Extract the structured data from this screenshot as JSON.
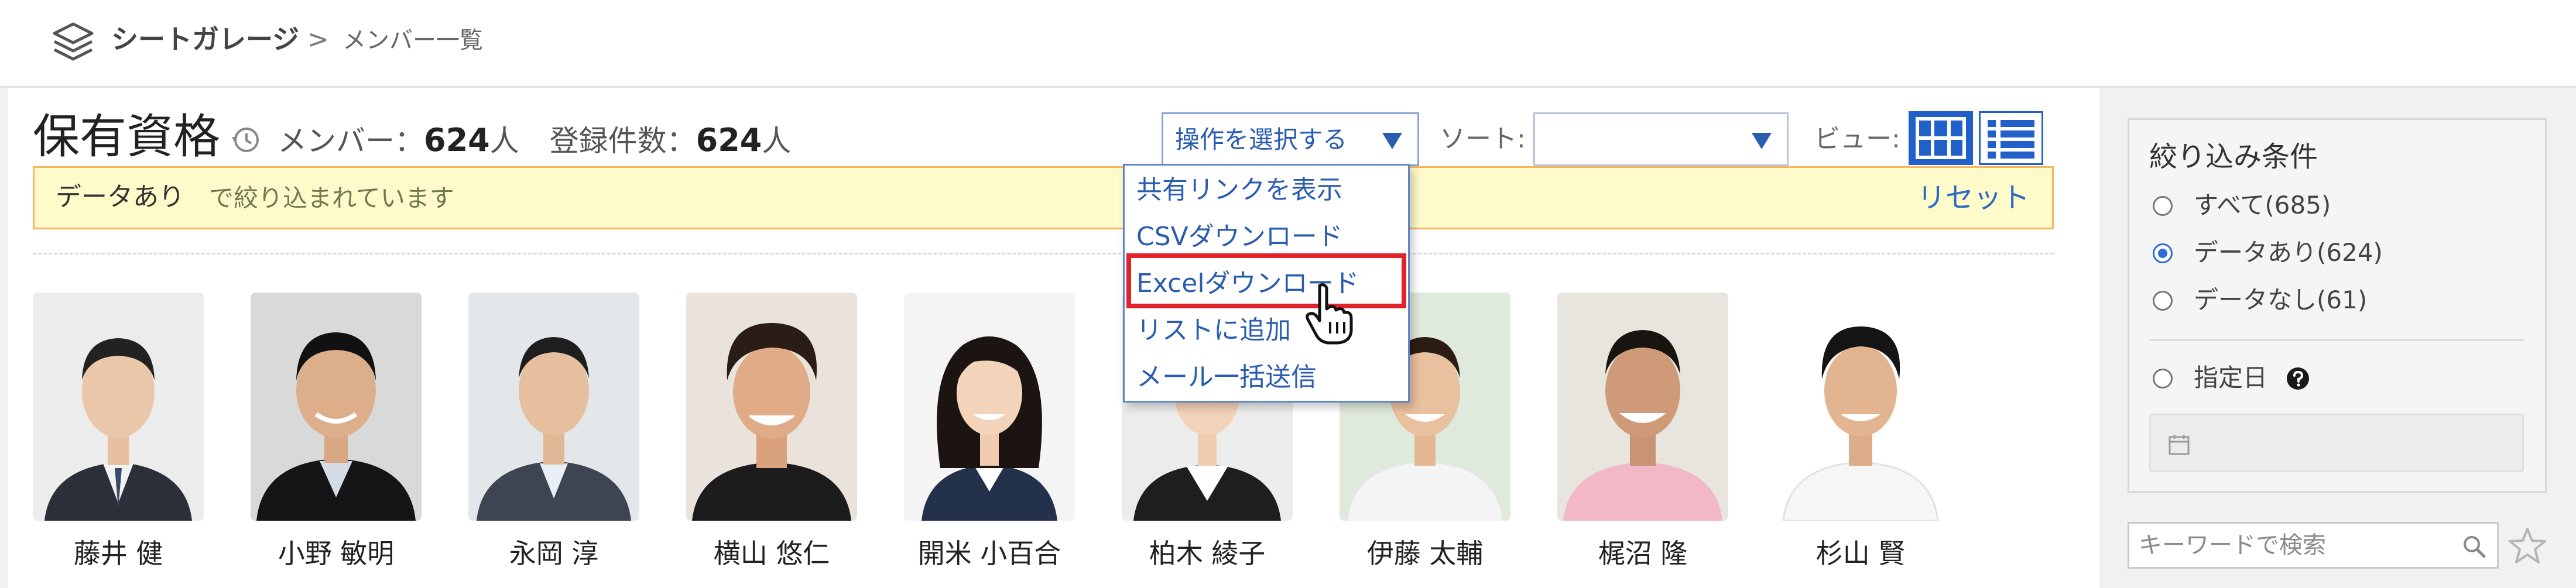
{
  "header": {
    "app_name": "シートガレージ",
    "breadcrumb_separator": ">",
    "current_page": "メンバー一覧"
  },
  "toolbar": {
    "page_title": "保有資格",
    "member_label": "メンバー：",
    "member_count": "624",
    "member_unit": "人",
    "record_label": "登録件数：",
    "record_count": "624",
    "record_unit": "人",
    "operation_select": "操作を選択する",
    "sort_label": "ソート:",
    "sort_value": "",
    "view_label": "ビュー:"
  },
  "filter_banner": {
    "filter_value": "データあり",
    "filter_suffix": "で絞り込まれています",
    "reset_label": "リセット"
  },
  "operation_menu": {
    "items": [
      {
        "label": "共有リンクを表示"
      },
      {
        "label": "CSVダウンロード"
      },
      {
        "label": "Excelダウンロード"
      },
      {
        "label": "リストに追加"
      },
      {
        "label": "メール一括送信"
      }
    ],
    "highlighted_index": 2
  },
  "members": [
    {
      "name": "藤井 健"
    },
    {
      "name": "小野 敏明"
    },
    {
      "name": "永岡 淳"
    },
    {
      "name": "横山 悠仁"
    },
    {
      "name": "開米 小百合"
    },
    {
      "name": "柏木 綾子"
    },
    {
      "name": "伊藤 太輔"
    },
    {
      "name": "梶沼 隆"
    },
    {
      "name": "杉山 賢"
    }
  ],
  "sidebar": {
    "title": "絞り込み条件",
    "options": [
      {
        "label": "すべて(685)",
        "checked": false
      },
      {
        "label": "データあり(624)",
        "checked": true
      },
      {
        "label": "データなし(61)",
        "checked": false
      }
    ],
    "date_option": "指定日",
    "date_value": ""
  },
  "search": {
    "placeholder": "キーワードで検索",
    "value": ""
  },
  "colors": {
    "accent": "#2060c8",
    "link": "#2a5db0",
    "banner_bg": "#fffaca",
    "banner_border": "#f2b760",
    "highlight": "#e0222b"
  },
  "icons": {
    "app": "layers-icon",
    "history": "history-icon",
    "grid_view": "grid-icon",
    "list_view": "list-icon",
    "cursor": "hand-cursor-icon",
    "help": "question-icon",
    "calendar": "calendar-icon",
    "search": "search-icon",
    "favorite": "star-icon"
  }
}
